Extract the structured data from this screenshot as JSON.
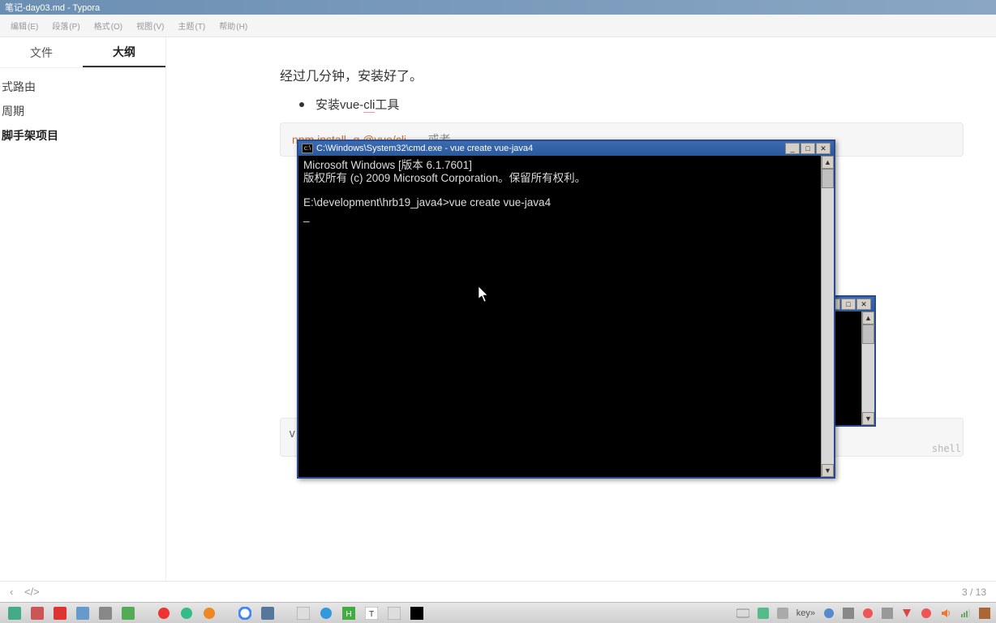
{
  "titlebar": {
    "text": "笔记-day03.md - Typora"
  },
  "menu": [
    {
      "label": "编辑",
      "key": "(E)"
    },
    {
      "label": "段落",
      "key": "(P)"
    },
    {
      "label": "格式",
      "key": "(O)"
    },
    {
      "label": "视图",
      "key": "(V)"
    },
    {
      "label": "主题",
      "key": "(T)"
    },
    {
      "label": "帮助",
      "key": "(H)"
    }
  ],
  "sidebar": {
    "tabs": {
      "files": "文件",
      "outline": "大纲"
    },
    "outline": [
      {
        "label": "式路由"
      },
      {
        "label": "周期"
      },
      {
        "label": "脚手架项目",
        "bold": true
      }
    ]
  },
  "content": {
    "installed": "经过几分钟，安装好了。",
    "bullet1": "安装vue-cli工具",
    "code1": {
      "cmd": "npm install -g @vue/cli",
      "comment": "或者"
    },
    "shellv": "v",
    "shellLabel": "shell"
  },
  "footer": {
    "back": "‹",
    "code": "</>",
    "pos": "3 / 13"
  },
  "cmd": {
    "title": "C:\\Windows\\System32\\cmd.exe - vue  create vue-java4",
    "line1": "Microsoft Windows [版本 6.1.7601]",
    "line2": "版权所有 (c) 2009 Microsoft Corporation。保留所有权利。",
    "line3": "E:\\development\\hrb19_java4>vue create vue-java4",
    "prompt": "_"
  },
  "tray": {
    "key": "key",
    "arrow": "»"
  }
}
